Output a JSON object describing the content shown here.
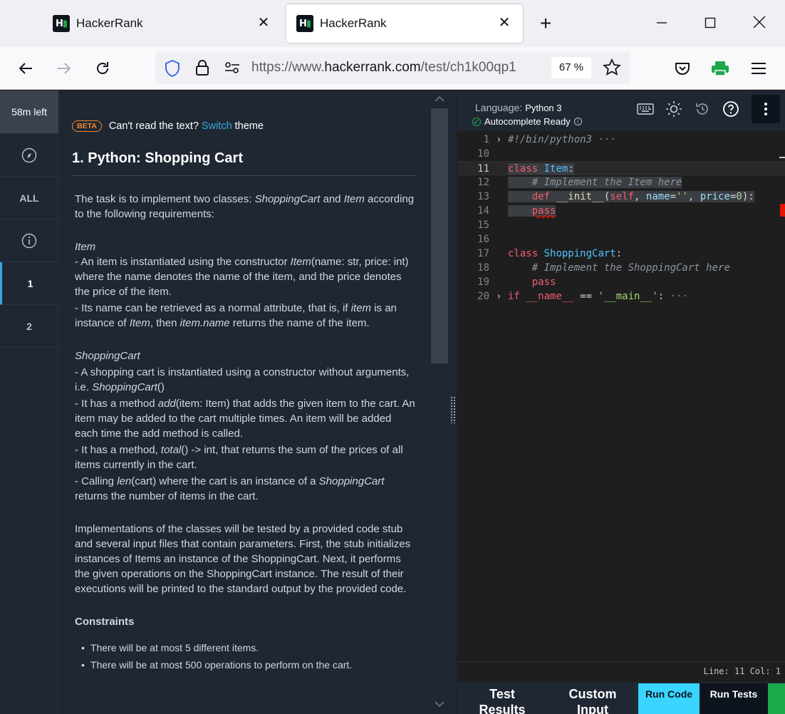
{
  "browser": {
    "tabs": [
      {
        "title": "HackerRank",
        "active": false
      },
      {
        "title": "HackerRank",
        "active": true
      }
    ],
    "url_prefix": "https://www.",
    "url_domain": "hackerrank.com",
    "url_path": "/test/ch1k00qp1",
    "zoom": "67 %",
    "new_tab": "+"
  },
  "rail": {
    "timer": "58m left",
    "all_label": "ALL",
    "questions": [
      "1",
      "2"
    ]
  },
  "problem": {
    "beta": "BETA",
    "theme_prompt": "Can't read the text?",
    "switch_link": "Switch",
    "theme_word": "theme",
    "title": "1. Python: Shopping Cart",
    "intro_a": "The task is to implement two classes: ",
    "intro_cls1": "ShoppingCart",
    "intro_and": " and ",
    "intro_cls2": "Item",
    "intro_b": " according to the following requirements:",
    "item_heading": "Item",
    "item_l1a": "- An item is instantiated using the constructor ",
    "item_l1i": "Item",
    "item_l1b": "(name: str, price: int) where the name denotes the name of the item, and the price denotes the price of the item.",
    "item_l2a": "- Its name can be retrieved as a normal attribute, that is, if ",
    "item_l2i1": "item",
    "item_l2b": " is an instance of ",
    "item_l2i2": "Item",
    "item_l2c": ", then ",
    "item_l2i3": "item.name",
    "item_l2d": " returns the name of the item.",
    "cart_heading": "ShoppingCart",
    "cart_l1a": "- A shopping cart is instantiated using a constructor without arguments, i.e. ",
    "cart_l1i": "ShoppingCart",
    "cart_l1b": "()",
    "cart_l2a": "- It has a method ",
    "cart_l2i": "add",
    "cart_l2b": "(item: Item) that adds the given item to the cart. An item may be added to the cart multiple times. An item will be added each time the add method is called.",
    "cart_l3a": "- It has a method, ",
    "cart_l3i": "total",
    "cart_l3b": "() -> int, that returns the sum of the prices of all items currently in the cart.",
    "cart_l4a": "- Calling ",
    "cart_l4i": "len",
    "cart_l4b": "(cart) where the cart is an instance of a ",
    "cart_l4i2": "ShoppingCart",
    "cart_l4c": " returns the number of items in the cart.",
    "impl": "Implementations of the classes will be tested by a provided code stub and several input files that contain parameters. First, the stub initializes instances of Items an instance of the ShoppingCart. Next, it performs the given operations on the ShoppingCart instance. The result of their executions will be printed to the standard output by the provided code.",
    "constraints_heading": "Constraints",
    "constraints": [
      "There will be at most 5 different items.",
      "There will be at most 500 operations to perform on the cart."
    ]
  },
  "editor": {
    "language_label": "Language:",
    "language": "Python 3",
    "autocomplete": "Autocomplete Ready",
    "line_numbers": [
      "1",
      "10",
      "11",
      "12",
      "13",
      "14",
      "15",
      "16",
      "17",
      "18",
      "19",
      "20"
    ],
    "status": "Line: 11 Col: 1"
  },
  "bottom": {
    "test_results": "Test Results",
    "custom_input": "Custom Input",
    "run_code": "Run Code",
    "run_tests": "Run Tests"
  },
  "colors": {
    "accent_green": "#1ba94c",
    "link_blue": "#39a8e0",
    "run_code_bg": "#39d5ff",
    "beta_orange": "#f2872d"
  }
}
